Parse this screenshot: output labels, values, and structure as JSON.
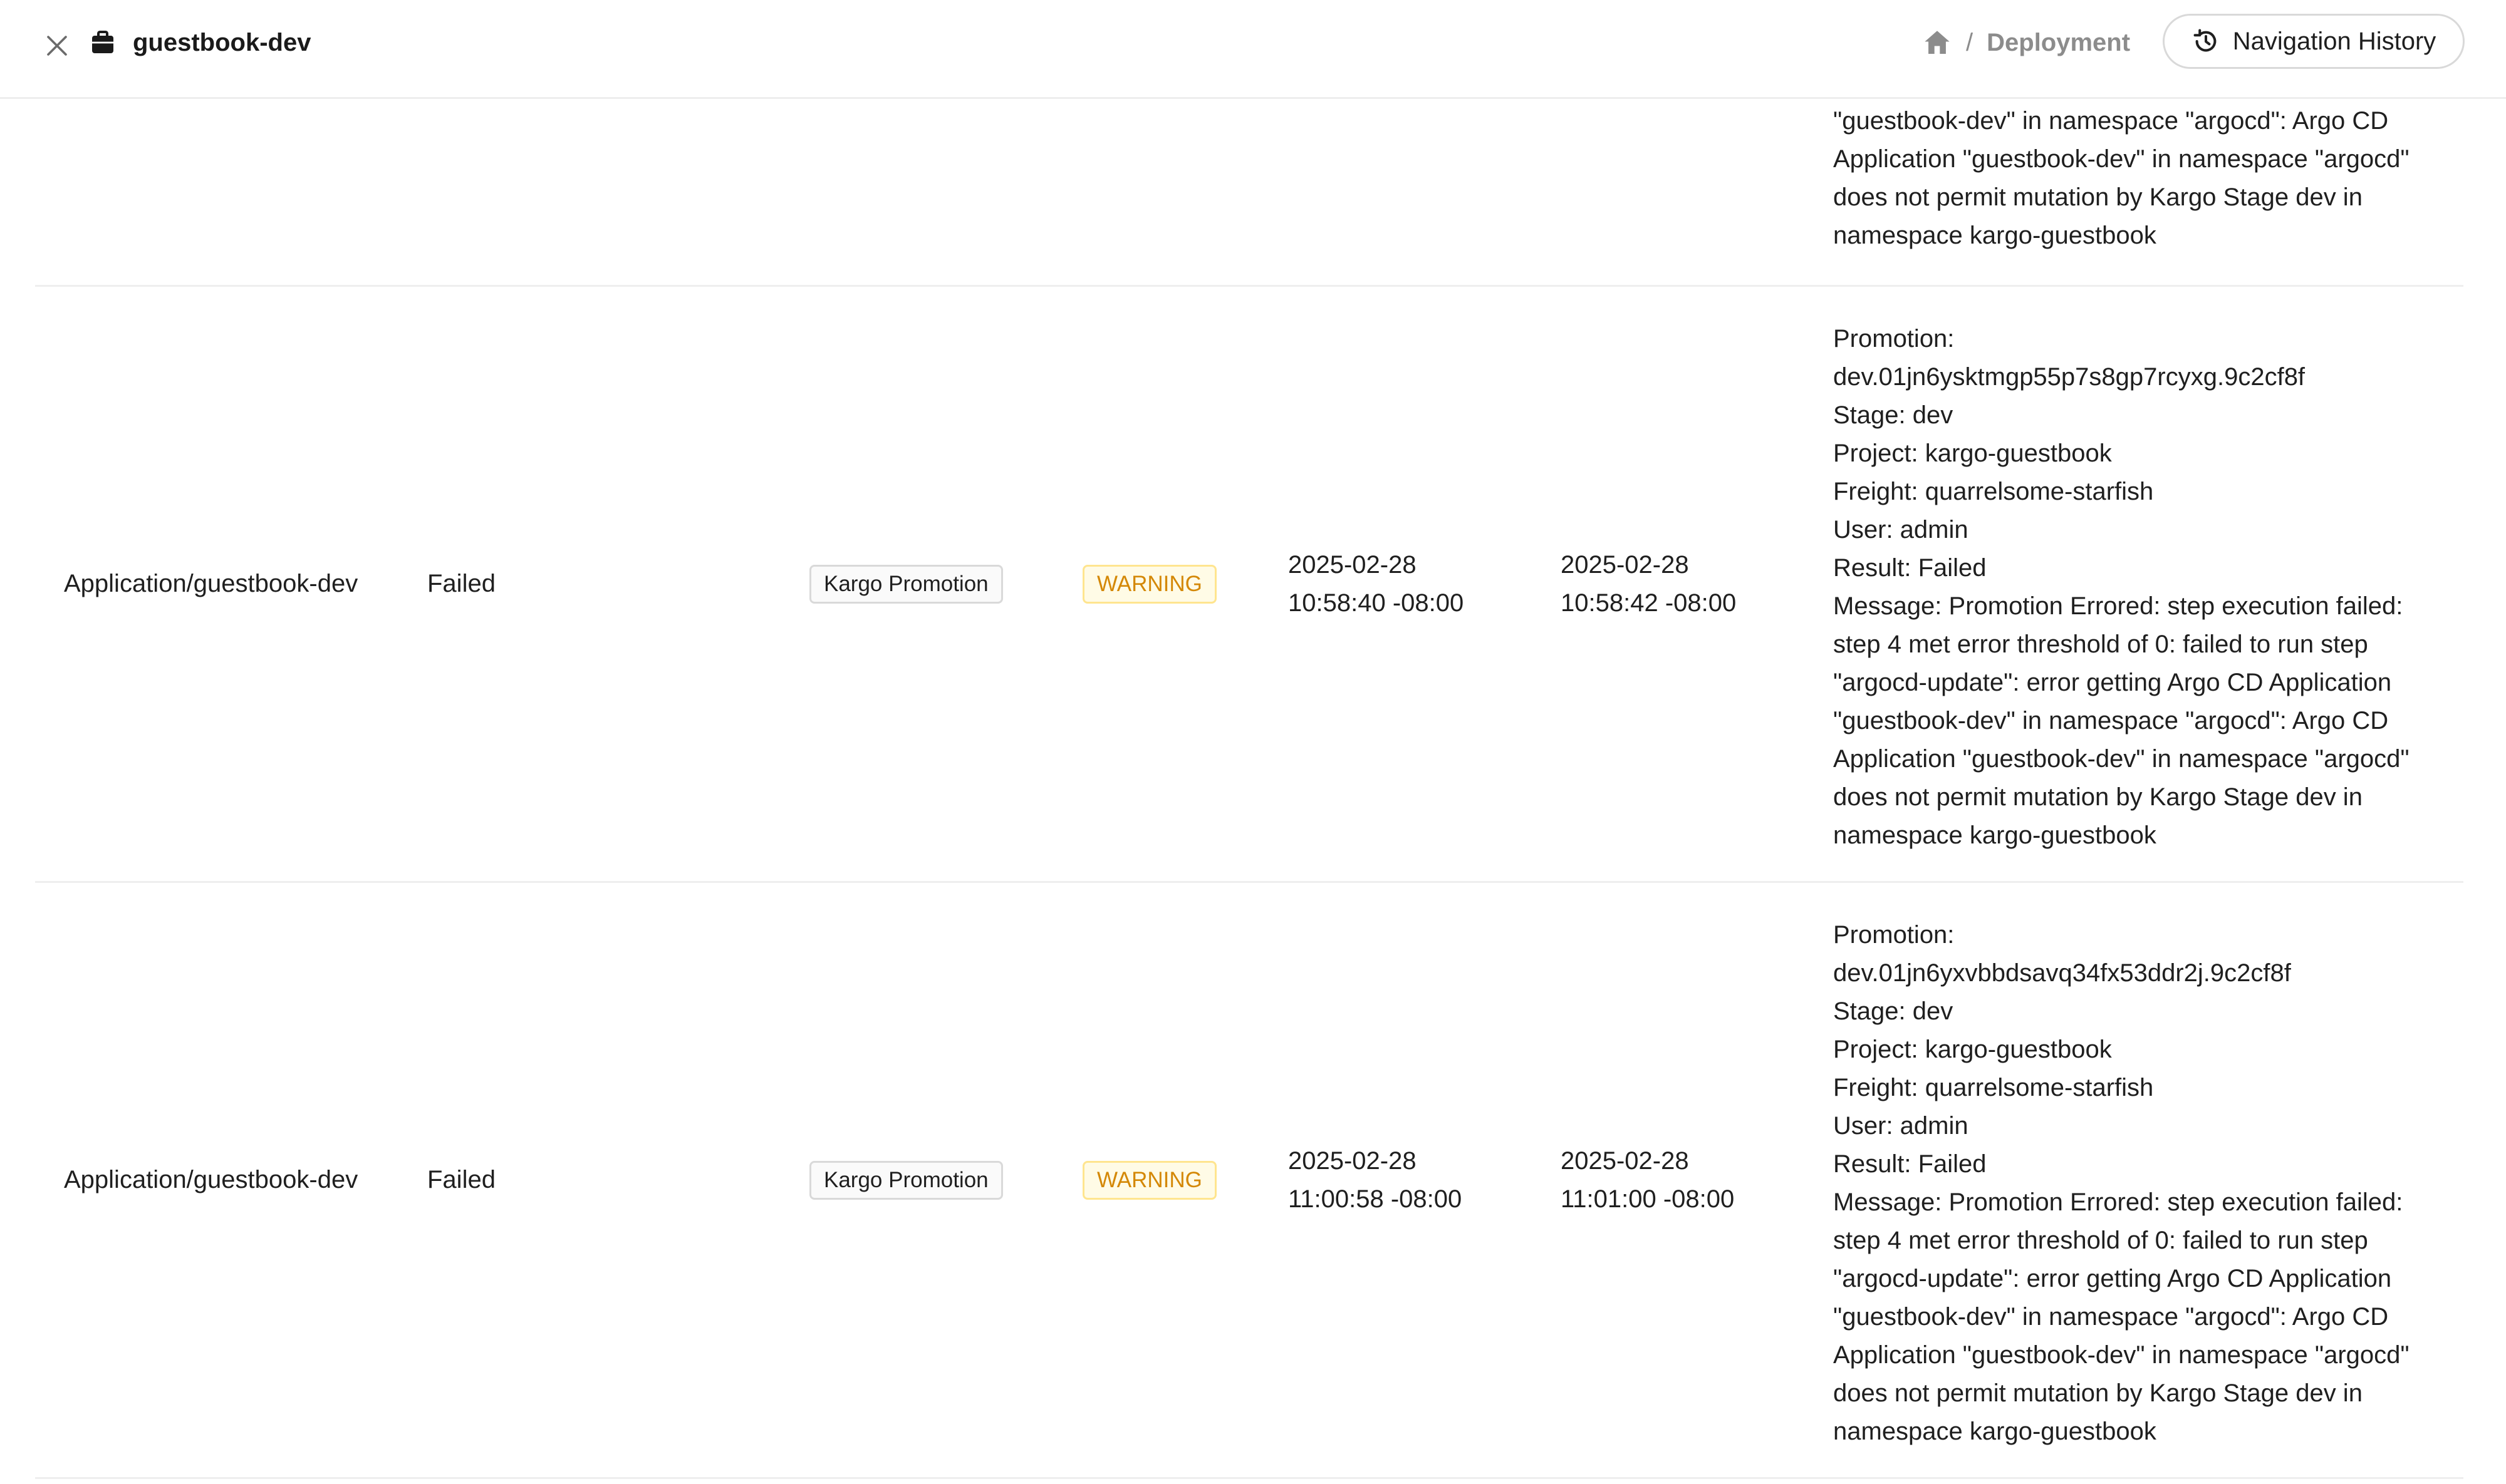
{
  "header": {
    "title": "guestbook-dev",
    "breadcrumb_separator": "/",
    "breadcrumb_current": "Deployment",
    "nav_history_label": "Navigation History"
  },
  "icons": {
    "close": "close-icon",
    "project": "briefcase-icon",
    "home": "home-icon",
    "history": "history-icon"
  },
  "colors": {
    "warning_text": "#d48806",
    "warning_bg": "#fffbe6",
    "warning_border": "#ffe58f",
    "muted": "#8c8c8c"
  },
  "events": [
    {
      "message": "\"guestbook-dev\" in namespace \"argocd\": Argo CD\nApplication \"guestbook-dev\" in namespace \"argocd\"\ndoes not permit mutation by Kargo Stage dev in\nnamespace kargo-guestbook"
    },
    {
      "object": "Application/guestbook-dev",
      "reason": "Failed",
      "source": "Kargo Promotion",
      "type": "WARNING",
      "first_seen": "2025-02-28\n10:58:40 -08:00",
      "last_seen": "2025-02-28\n10:58:42 -08:00",
      "message": "Promotion:\ndev.01jn6ysktmgp55p7s8gp7rcyxg.9c2cf8f\nStage: dev\nProject: kargo-guestbook\nFreight: quarrelsome-starfish\nUser: admin\nResult: Failed\nMessage: Promotion Errored: step execution failed:\nstep 4 met error threshold of 0: failed to run step\n\"argocd-update\": error getting Argo CD Application\n\"guestbook-dev\" in namespace \"argocd\": Argo CD\nApplication \"guestbook-dev\" in namespace \"argocd\"\ndoes not permit mutation by Kargo Stage dev in\nnamespace kargo-guestbook"
    },
    {
      "object": "Application/guestbook-dev",
      "reason": "Failed",
      "source": "Kargo Promotion",
      "type": "WARNING",
      "first_seen": "2025-02-28\n11:00:58 -08:00",
      "last_seen": "2025-02-28\n11:01:00 -08:00",
      "message": "Promotion:\ndev.01jn6yxvbbdsavq34fx53ddr2j.9c2cf8f\nStage: dev\nProject: kargo-guestbook\nFreight: quarrelsome-starfish\nUser: admin\nResult: Failed\nMessage: Promotion Errored: step execution failed:\nstep 4 met error threshold of 0: failed to run step\n\"argocd-update\": error getting Argo CD Application\n\"guestbook-dev\" in namespace \"argocd\": Argo CD\nApplication \"guestbook-dev\" in namespace \"argocd\"\ndoes not permit mutation by Kargo Stage dev in\nnamespace kargo-guestbook"
    }
  ]
}
